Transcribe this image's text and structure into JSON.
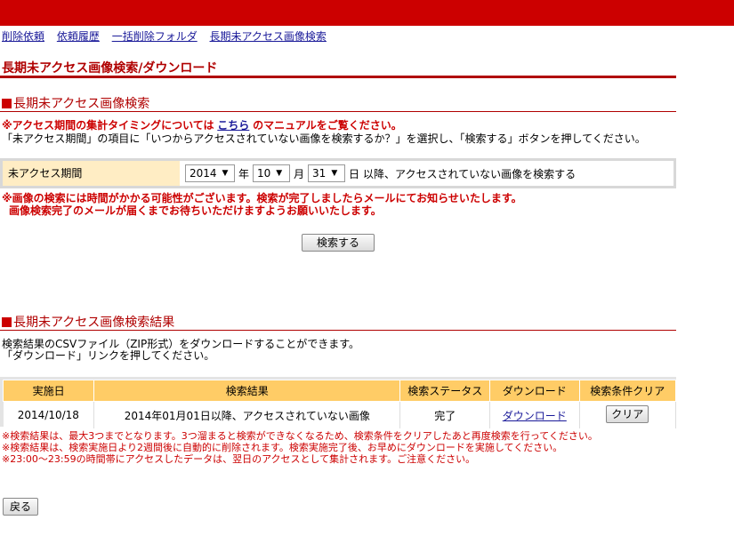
{
  "nav": {
    "items": [
      "削除依頼",
      "依頼履歴",
      "一括削除フォルダ",
      "長期未アクセス画像検索"
    ]
  },
  "page_title": "長期未アクセス画像検索/ダウンロード",
  "search_section": {
    "title": "長期未アクセス画像検索",
    "notice_prefix": "※アクセス期間の集計タイミングについては",
    "notice_link": "こちら",
    "notice_suffix": "のマニュアルをご覧ください。",
    "instruction": "「未アクセス期間」の項目に「いつからアクセスされていない画像を検索するか？」を選択し、「検索する」ボタンを押してください。",
    "form": {
      "label": "未アクセス期間",
      "year": "2014",
      "year_unit": "年",
      "month": "10",
      "month_unit": "月",
      "day": "31",
      "day_unit": "日",
      "suffix": "以降、アクセスされていない画像を検索する"
    },
    "warning_1": "※画像の検索には時間がかかる可能性がございます。検索が完了しましたらメールにてお知らせいたします。",
    "warning_2": "画像検索完了のメールが届くまでお待ちいただけますようお願いいたします。",
    "search_button": "検索する"
  },
  "results_section": {
    "title": "長期未アクセス画像検索結果",
    "desc_1": "検索結果のCSVファイル（ZIP形式）をダウンロードすることができます。",
    "desc_2": "「ダウンロード」リンクを押してください。",
    "table": {
      "headers": [
        "実施日",
        "検索結果",
        "検索ステータス",
        "ダウンロード",
        "検索条件クリア"
      ],
      "row": {
        "date": "2014/10/18",
        "result": "2014年01月01日以降、アクセスされていない画像",
        "status": "完了",
        "download": "ダウンロード",
        "clear": "クリア"
      }
    },
    "notes": [
      "※検索結果は、最大3つまでとなります。3つ溜まると検索ができなくなるため、検索条件をクリアしたあと再度検索を行ってください。",
      "※検索結果は、検索実施日より2週間後に自動的に削除されます。検索実施完了後、お早めにダウンロードを実施してください。",
      "※23:00～23:59の時間帯にアクセスしたデータは、翌日のアクセスとして集計されます。ご注意ください。"
    ]
  },
  "back_button": "戻る",
  "colors": {
    "brand_red": "#cc0000",
    "header_yellow": "#ffcc66",
    "label_bg": "#ffedc4",
    "link_blue": "#1a1a99"
  }
}
